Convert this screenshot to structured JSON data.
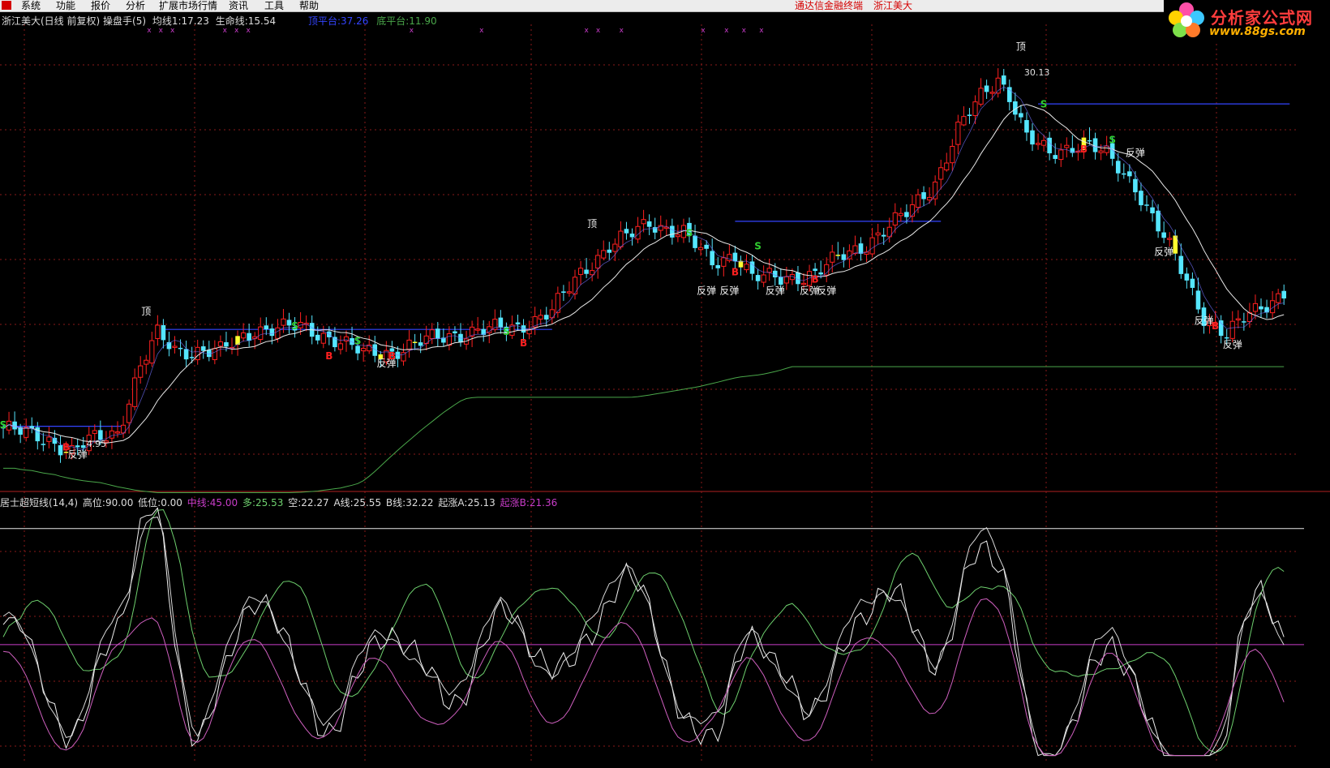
{
  "menubar": {
    "items": [
      "系统",
      "功能",
      "报价",
      "分析",
      "扩展市场行情",
      "资讯",
      "工具",
      "帮助"
    ],
    "broker": "通达信金融终端",
    "stock": "浙江美大"
  },
  "logo": {
    "name": "分析家公式网",
    "url": "www.88gs.com"
  },
  "price_panel": {
    "stock_title": "浙江美大(日线 前复权)",
    "indicator_name": "操盘手(5)",
    "ma1_label": "均线1:",
    "ma1_value": "17.23",
    "life_label": "生命线:",
    "life_value": "15.54",
    "top_platform_label": "顶平台:",
    "top_platform_value": "37.26",
    "bottom_platform_label": "底平台:",
    "bottom_platform_value": "11.90"
  },
  "osc_panel": {
    "indicator_name": "居士超短线(14,4)",
    "high_label": "高位:",
    "high_value": "90.00",
    "low_label": "低位:",
    "low_value": "0.00",
    "mid_label": "中线:",
    "mid_value": "45.00",
    "long_label": "多:",
    "long_value": "25.53",
    "short_label": "空:",
    "short_value": "22.27",
    "a_label": "A线:",
    "a_value": "25.55",
    "b_label": "B线:",
    "b_value": "32.22",
    "rise_a_label": "起涨A:",
    "rise_a_value": "25.13",
    "rise_b_label": "起涨B:",
    "rise_b_value": "21.36"
  },
  "colors": {
    "up": "#ff2020",
    "down": "#55e6ff",
    "yellow": "#ffff30",
    "ma": "#e8e8e8",
    "life": "#4aa74a",
    "platform": "#3344ff",
    "mid": "#c83cc8",
    "grid": "#8a1a1a"
  },
  "chart_data": [
    {
      "type": "candlestick",
      "ylim": [
        8.5,
        32
      ],
      "price_labels": [
        {
          "text": "30.13",
          "x": 178,
          "y": 30.13
        },
        {
          "text": "4.95",
          "x": 14,
          "y": 10.2
        }
      ],
      "annotations": [
        {
          "text": "顶",
          "x": 25,
          "y": 17.3
        },
        {
          "text": "顶",
          "x": 103,
          "y": 22.0
        },
        {
          "text": "顶",
          "x": 178,
          "y": 31.5
        },
        {
          "text": "反弹",
          "x": 13,
          "y": 9.6
        },
        {
          "text": "反弹",
          "x": 67,
          "y": 14.5
        },
        {
          "text": "反弹",
          "x": 123,
          "y": 18.4
        },
        {
          "text": "反弹",
          "x": 127,
          "y": 18.4
        },
        {
          "text": "反弹",
          "x": 135,
          "y": 18.4
        },
        {
          "text": "反弹",
          "x": 141,
          "y": 18.4
        },
        {
          "text": "反弹",
          "x": 144,
          "y": 18.4
        },
        {
          "text": "反弹",
          "x": 198,
          "y": 25.8
        },
        {
          "text": "反弹",
          "x": 203,
          "y": 20.5
        },
        {
          "text": "反弹",
          "x": 210,
          "y": 16.8
        },
        {
          "text": "反弹",
          "x": 215,
          "y": 15.5
        }
      ],
      "signals": [
        {
          "text": "S",
          "x": 0,
          "y": 11.2
        },
        {
          "text": "S",
          "x": 51,
          "y": 16.5
        },
        {
          "text": "S",
          "x": 62,
          "y": 15.7
        },
        {
          "text": "S",
          "x": 88,
          "y": 16.2
        },
        {
          "text": "S",
          "x": 120,
          "y": 21.5
        },
        {
          "text": "S",
          "x": 132,
          "y": 20.8
        },
        {
          "text": "S",
          "x": 182,
          "y": 28.4
        },
        {
          "text": "S",
          "x": 194,
          "y": 26.5
        },
        {
          "text": "B",
          "x": 11,
          "y": 10.0
        },
        {
          "text": "B",
          "x": 57,
          "y": 14.9
        },
        {
          "text": "B",
          "x": 68,
          "y": 14.9
        },
        {
          "text": "B",
          "x": 91,
          "y": 15.6
        },
        {
          "text": "B",
          "x": 128,
          "y": 19.4
        },
        {
          "text": "B",
          "x": 142,
          "y": 19.0
        },
        {
          "text": "B",
          "x": 189,
          "y": 26.0
        },
        {
          "text": "B",
          "x": 212,
          "y": 16.5
        }
      ],
      "top_markers_x": [
        25,
        27,
        29,
        38,
        40,
        42,
        70,
        82,
        100,
        102,
        106,
        120,
        124,
        127,
        130
      ]
    },
    {
      "type": "line",
      "ylim": [
        0,
        100
      ],
      "levels": [
        {
          "name": "高位",
          "value": 90
        },
        {
          "name": "中线",
          "value": 45
        }
      ]
    }
  ]
}
